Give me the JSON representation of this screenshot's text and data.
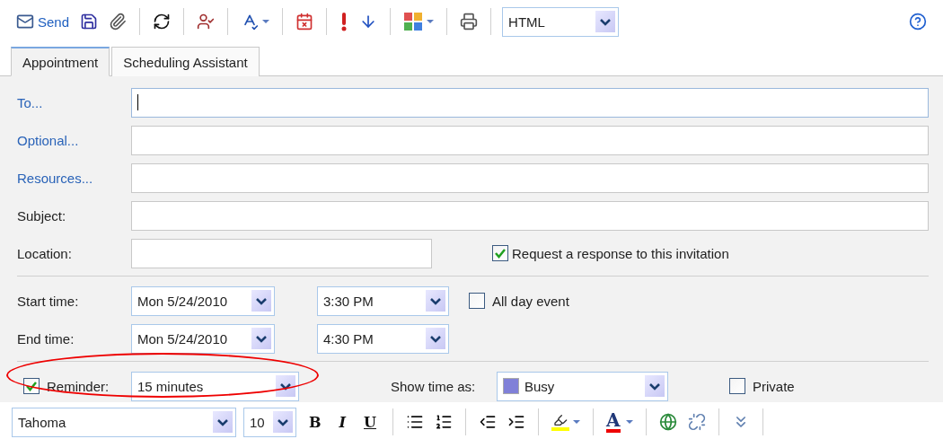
{
  "toolbar": {
    "send_label": "Send",
    "format": "HTML"
  },
  "tabs": [
    {
      "label": "Appointment",
      "selected": true
    },
    {
      "label": "Scheduling Assistant",
      "selected": false
    }
  ],
  "address_fields": [
    {
      "label": "To...",
      "kind": "link",
      "focused": true
    },
    {
      "label": "Optional...",
      "kind": "link",
      "focused": false
    },
    {
      "label": "Resources...",
      "kind": "link",
      "focused": false
    },
    {
      "label": "Subject:",
      "kind": "plain",
      "focused": false
    }
  ],
  "location": {
    "label": "Location:",
    "request_response": {
      "label": "Request a response to this invitation",
      "checked": true
    }
  },
  "times": [
    {
      "label": "Start time:",
      "date": "Mon 5/24/2010",
      "time": "3:30 PM"
    },
    {
      "label": "End time:",
      "date": "Mon 5/24/2010",
      "time": "4:30 PM"
    }
  ],
  "all_day": {
    "label": "All day event",
    "checked": false
  },
  "reminder": {
    "label": "Reminder:",
    "checked": true,
    "value": "15 minutes"
  },
  "show_time_as": {
    "label": "Show time as:",
    "value": "Busy"
  },
  "private": {
    "label": "Private",
    "checked": false
  },
  "formatting": {
    "font": "Tahoma",
    "size": "10",
    "style_buttons": [
      "B",
      "I",
      "U"
    ],
    "font_color_label": "A"
  }
}
